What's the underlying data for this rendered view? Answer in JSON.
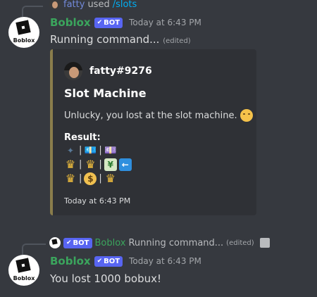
{
  "msg1": {
    "reply": {
      "user": "fatty",
      "verb": "used",
      "command": "/slots"
    },
    "author": "Boblox",
    "badge": "BOT",
    "timestamp": "Today at 6:43 PM",
    "text": "Running command...",
    "edited": "(edited)",
    "avatar_text": "Boblox"
  },
  "embed": {
    "author": "fatty#9276",
    "title": "Slot Machine",
    "description": "Unlucky, you lost at the slot machine.",
    "field_name": "Result:",
    "footer": "Today at 6:43 PM",
    "border_color": "#8a7d4b",
    "separator": "|",
    "slots": [
      [
        "sparkles-icon",
        "cash-icon",
        "cash-icon"
      ],
      [
        "crown-icon",
        "crown-icon",
        "chart-icon",
        "left-arrow-icon"
      ],
      [
        "crown-icon",
        "money-bag-icon",
        "crown-icon"
      ]
    ]
  },
  "msg2": {
    "reply": {
      "badge": "BOT",
      "user": "Boblox",
      "text": "Running command...",
      "edited": "(edited)"
    },
    "author": "Boblox",
    "badge": "BOT",
    "timestamp": "Today at 6:43 PM",
    "text": "You lost 1000 bobux!",
    "avatar_text": "Boblox"
  },
  "colors": {
    "background": "#36393f",
    "embed_bg": "#2f3136",
    "username": "#3ba55d",
    "command_link": "#00aff4",
    "bot_badge": "#5865f2"
  }
}
